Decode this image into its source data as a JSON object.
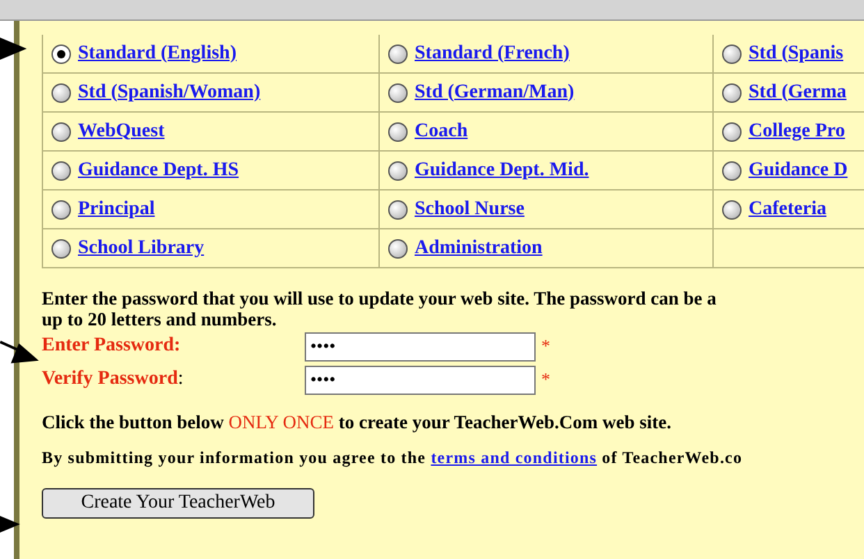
{
  "options": [
    {
      "label": "Standard (English)",
      "selected": true
    },
    {
      "label": "Standard (French)",
      "selected": false
    },
    {
      "label": "Std (Spanis",
      "selected": false
    },
    {
      "label": "Std (Spanish/Woman)",
      "selected": false
    },
    {
      "label": "Std (German/Man)",
      "selected": false
    },
    {
      "label": "Std (Germa",
      "selected": false
    },
    {
      "label": "WebQuest",
      "selected": false
    },
    {
      "label": "Coach",
      "selected": false
    },
    {
      "label": "College Pro",
      "selected": false
    },
    {
      "label": "Guidance Dept. HS",
      "selected": false
    },
    {
      "label": "Guidance Dept. Mid.",
      "selected": false
    },
    {
      "label": "Guidance D",
      "selected": false
    },
    {
      "label": "Principal",
      "selected": false
    },
    {
      "label": "School Nurse",
      "selected": false
    },
    {
      "label": "Cafeteria",
      "selected": false
    },
    {
      "label": "School Library",
      "selected": false
    },
    {
      "label": "Administration",
      "selected": false
    }
  ],
  "password_intro": "Enter the password that you will use to update your web site. The password can be a",
  "password_intro_2": "up to 20 letters and numbers.",
  "fields": [
    {
      "label": "Enter Password:",
      "value": "••••",
      "required": "*"
    },
    {
      "label": "Verify Password",
      "suffix": ":",
      "value": "••••",
      "required": "*"
    }
  ],
  "click_note": {
    "before": "Click the button below ",
    "emphasis": "ONLY ONCE",
    "after": " to create your TeacherWeb.Com web site."
  },
  "terms_note": {
    "before": "By submitting your information you agree to the ",
    "link": "terms and conditions",
    "after": " of TeacherWeb.co"
  },
  "button": "Create Your TeacherWeb"
}
